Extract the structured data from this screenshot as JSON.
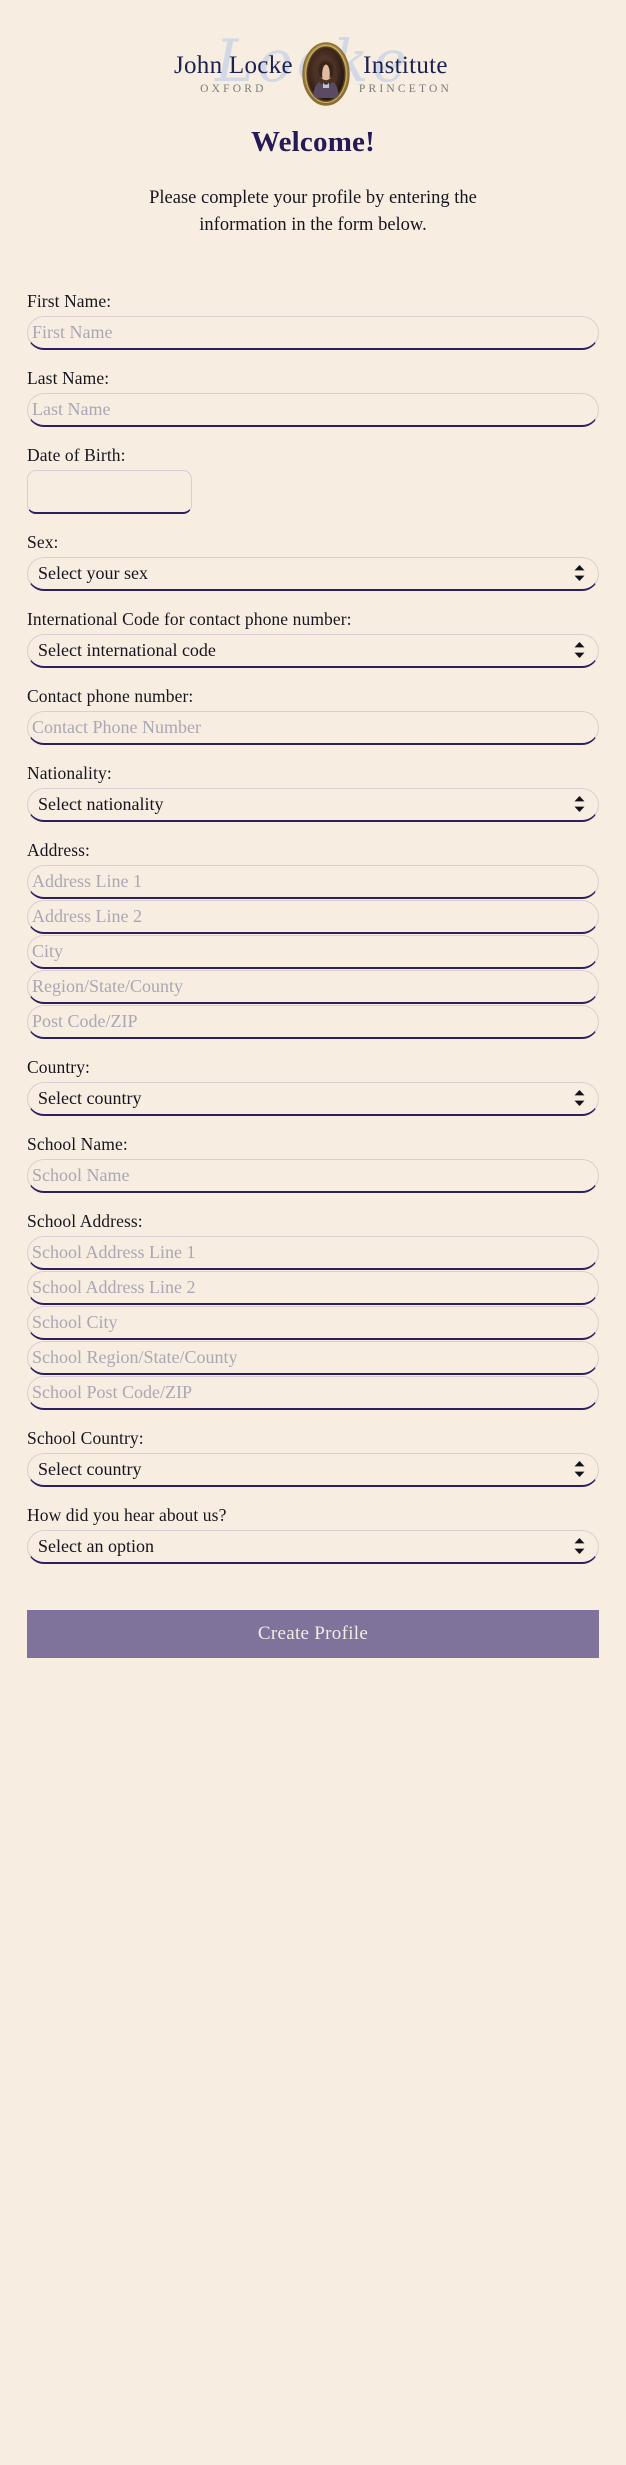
{
  "colors": {
    "background": "#f7eee1",
    "heading": "#241a56",
    "text": "#16161e",
    "placeholder": "#a9a7b5",
    "field_underline": "#2d2060",
    "field_border": "#d9cfd2",
    "button_bg": "#80739b",
    "button_text": "#f3ece2",
    "logo_navy": "#1c2250",
    "logo_gray": "#7a7a7a",
    "logo_script": "#ccd5e6"
  },
  "logo": {
    "script_watermark": "Locke",
    "left_word": "John Locke",
    "left_sub": "OXFORD",
    "right_word": "Institute",
    "right_sub": "PRINCETON",
    "medallion_alt": "portrait-medallion"
  },
  "header": {
    "welcome": "Welcome!",
    "subtitle": "Please complete your profile by entering the information in the form below."
  },
  "form": {
    "first_name": {
      "label": "First Name:",
      "placeholder": "First Name",
      "value": ""
    },
    "last_name": {
      "label": "Last Name:",
      "placeholder": "Last Name",
      "value": ""
    },
    "dob": {
      "label": "Date of Birth:",
      "value": ""
    },
    "sex": {
      "label": "Sex:",
      "selected": "Select your sex"
    },
    "intl_code": {
      "label": "International Code for contact phone number:",
      "selected": "Select international code"
    },
    "phone": {
      "label": "Contact phone number:",
      "placeholder": "Contact Phone Number",
      "value": ""
    },
    "nationality": {
      "label": "Nationality:",
      "selected": "Select nationality"
    },
    "address": {
      "label": "Address:",
      "lines": [
        {
          "placeholder": "Address Line 1",
          "value": ""
        },
        {
          "placeholder": "Address Line 2",
          "value": ""
        },
        {
          "placeholder": "City",
          "value": ""
        },
        {
          "placeholder": "Region/State/County",
          "value": ""
        },
        {
          "placeholder": "Post Code/ZIP",
          "value": ""
        }
      ]
    },
    "country": {
      "label": "Country:",
      "selected": "Select country"
    },
    "school_name": {
      "label": "School Name:",
      "placeholder": "School Name",
      "value": ""
    },
    "school_address": {
      "label": "School Address:",
      "lines": [
        {
          "placeholder": "School Address Line 1",
          "value": ""
        },
        {
          "placeholder": "School Address Line 2",
          "value": ""
        },
        {
          "placeholder": "School City",
          "value": ""
        },
        {
          "placeholder": "School Region/State/County",
          "value": ""
        },
        {
          "placeholder": "School Post Code/ZIP",
          "value": ""
        }
      ]
    },
    "school_country": {
      "label": "School Country:",
      "selected": "Select country"
    },
    "referral": {
      "label": "How did you hear about us?",
      "selected": "Select an option"
    },
    "submit_label": "Create Profile"
  }
}
